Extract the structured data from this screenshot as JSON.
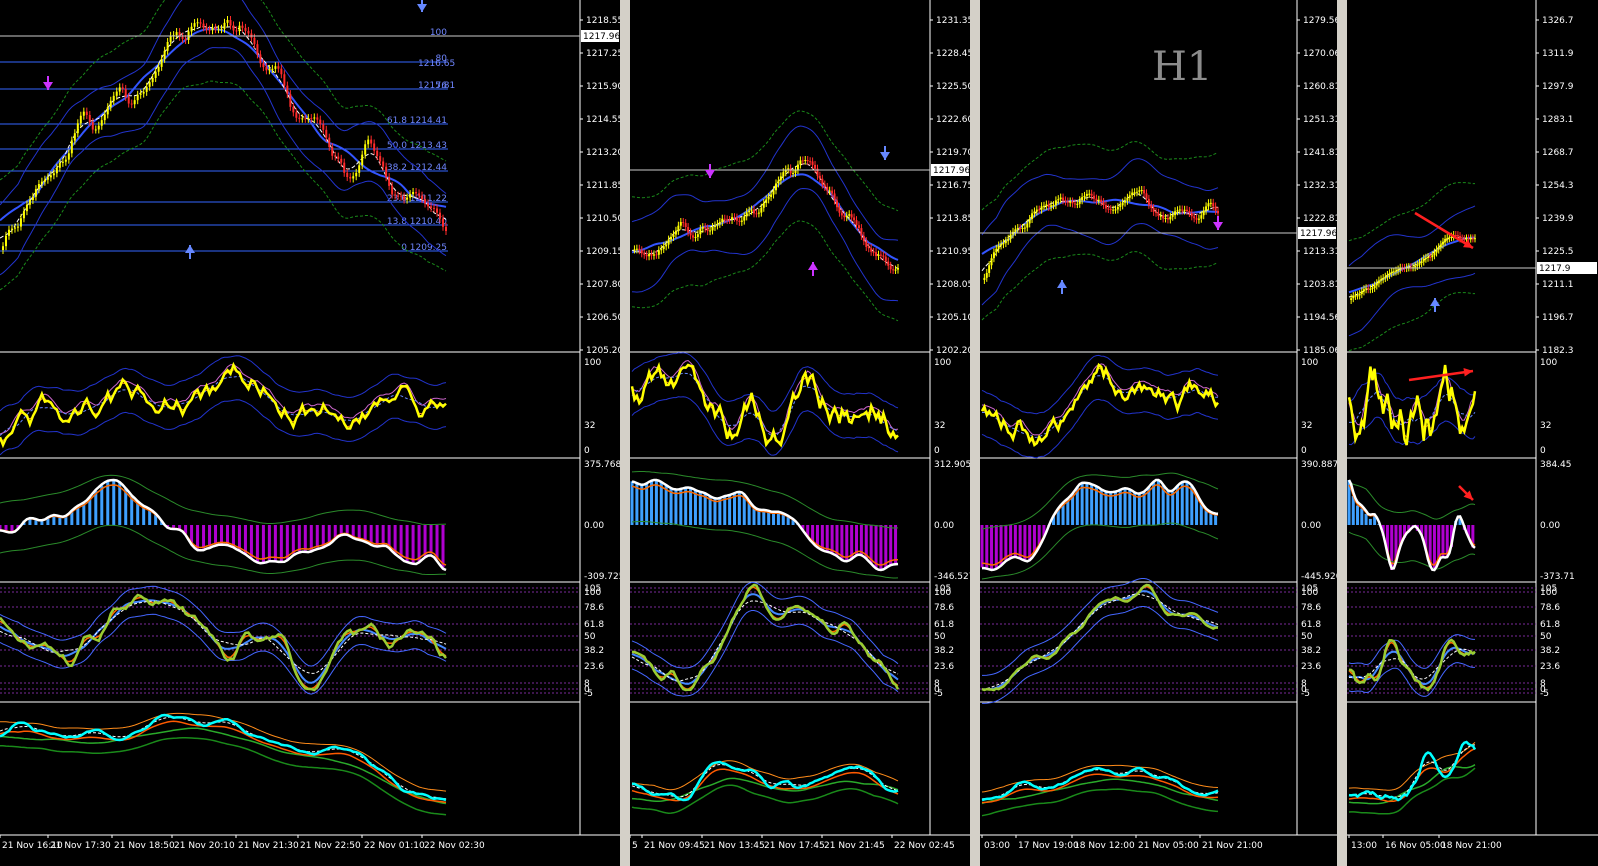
{
  "current_price_label": "1217.96",
  "timeframe_label": "H1",
  "colors": {
    "background": "#000000",
    "separator": "#d4d0c8",
    "bull_candle": "#ffff00",
    "bear_candle": "#ff2b2b",
    "fib_line": "#3366ff",
    "stoch_main": "#ffff00",
    "macd_hist_up": "#3ea0ff",
    "macd_hist_down": "#b000d0",
    "rsi_band": "#cccc33",
    "cyan_line": "#00ffff",
    "arrow_red": "#ff2020"
  },
  "panels": [
    {
      "id": "p1",
      "price_ticks": [
        "1218.55",
        "1217.25",
        "1215.90",
        "1214.55",
        "1213.20",
        "1211.85",
        "1210.50",
        "1209.15",
        "1207.80",
        "1206.50",
        "1205.20"
      ],
      "fib_labels": [
        "100",
        "80",
        "76",
        "61.8 1214.41",
        "50.0 1213.43",
        "38.2 1212.44",
        "23.6 1211.22",
        "13.8 1210.40",
        "0 1209.25"
      ],
      "fib_side_values": [
        "1216.65",
        "1215.81"
      ],
      "stoch_ticks": [
        "100",
        "32",
        "0"
      ],
      "macd_ticks": [
        "375.7683",
        "0.00",
        "-309.7255"
      ],
      "rsi_ticks": [
        "105",
        "100",
        "78.6",
        "61.8",
        "50",
        "38.2",
        "23.6",
        "8",
        "0",
        "-5"
      ],
      "time_labels": [
        "21 Nov 16:10",
        "21 Nov 17:30",
        "21 Nov 18:50",
        "21 Nov 20:10",
        "21 Nov 21:30",
        "21 Nov 22:50",
        "22 Nov 01:10",
        "22 Nov 02:30"
      ]
    },
    {
      "id": "p2",
      "price_ticks": [
        "1231.35",
        "1228.45",
        "1225.50",
        "1222.60",
        "1219.70",
        "1216.75",
        "1213.85",
        "1210.95",
        "1208.05",
        "1205.10",
        "1202.20"
      ],
      "stoch_ticks": [
        "100",
        "32",
        "0"
      ],
      "macd_ticks": [
        "312.9057",
        "0.00",
        "-346.527"
      ],
      "rsi_ticks": [
        "105",
        "100",
        "78.6",
        "61.8",
        "50",
        "38.2",
        "23.6",
        "8",
        "0",
        "-5"
      ],
      "time_labels": [
        "5",
        "21 Nov 09:45",
        "21 Nov 13:45",
        "21 Nov 17:45",
        "21 Nov 21:45",
        "22 Nov 02:45"
      ]
    },
    {
      "id": "p3",
      "price_ticks": [
        "1279.56",
        "1270.06",
        "1260.81",
        "1251.31",
        "1241.81",
        "1232.31",
        "1222.81",
        "1213.31",
        "1203.81",
        "1194.56",
        "1185.06"
      ],
      "stoch_ticks": [
        "100",
        "32",
        "0"
      ],
      "macd_ticks": [
        "390.8871",
        "0.00",
        "-445.9201"
      ],
      "rsi_ticks": [
        "105",
        "100",
        "78.6",
        "61.8",
        "50",
        "38.2",
        "23.6",
        "8",
        "0",
        "-5"
      ],
      "time_labels": [
        "03:00",
        "17 Nov 19:00",
        "18 Nov 12:00",
        "21 Nov 05:00",
        "21 Nov 21:00"
      ]
    },
    {
      "id": "p4",
      "price_ticks": [
        "1326.7",
        "1311.9",
        "1297.9",
        "1283.1",
        "1268.7",
        "1254.3",
        "1239.9",
        "1225.5",
        "1211.1",
        "1196.7",
        "1182.3"
      ],
      "current_price_partial": "1217.9",
      "stoch_ticks": [
        "100",
        "32",
        "0"
      ],
      "macd_ticks": [
        "384.45",
        "0.00",
        "-373.71"
      ],
      "rsi_ticks": [
        "105",
        "100",
        "78.6",
        "61.8",
        "50",
        "38.2",
        "23.6",
        "8",
        "0",
        "-5"
      ],
      "time_labels": [
        "13:00",
        "16 Nov 05:00",
        "18 Nov 21:00"
      ]
    }
  ]
}
